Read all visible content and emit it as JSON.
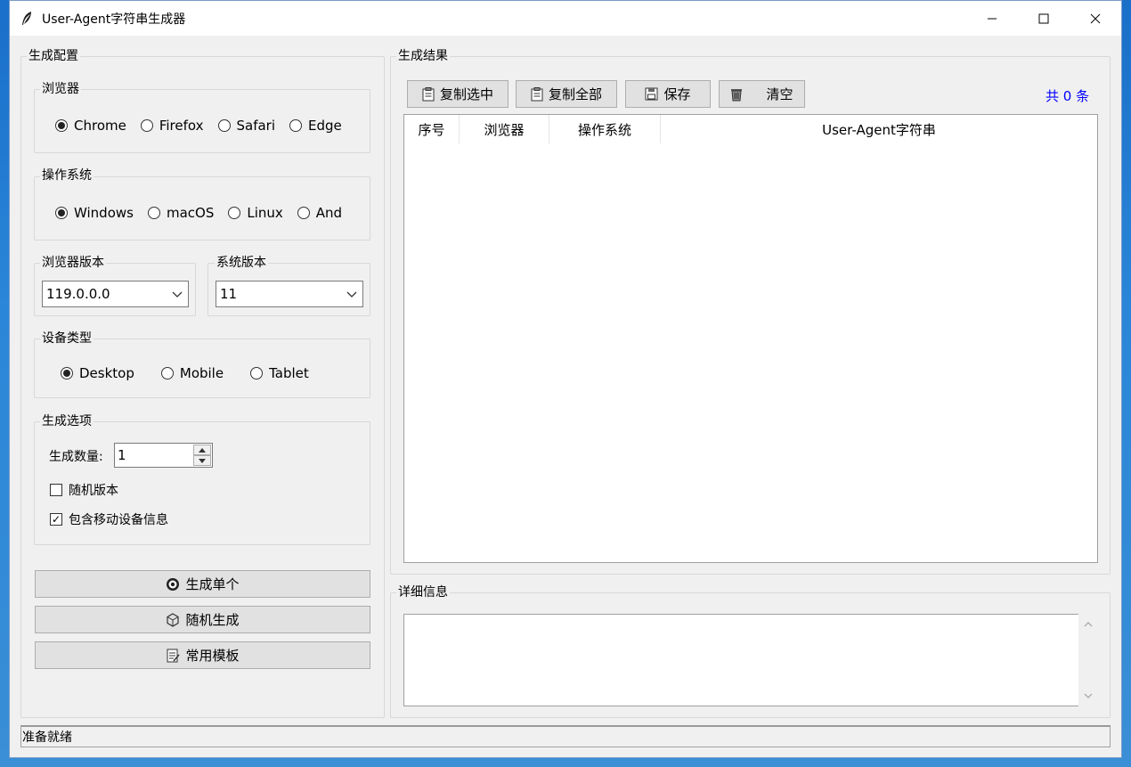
{
  "window": {
    "title": "User-Agent字符串生成器"
  },
  "config": {
    "title": "生成配置",
    "browser": {
      "title": "浏览器",
      "options": [
        "Chrome",
        "Firefox",
        "Safari",
        "Edge"
      ],
      "selected": "Chrome"
    },
    "os": {
      "title": "操作系统",
      "options": [
        "Windows",
        "macOS",
        "Linux",
        "And"
      ],
      "selected": "Windows"
    },
    "browser_version": {
      "title": "浏览器版本",
      "value": "119.0.0.0"
    },
    "os_version": {
      "title": "系统版本",
      "value": "11"
    },
    "device": {
      "title": "设备类型",
      "options": [
        "Desktop",
        "Mobile",
        "Tablet"
      ],
      "selected": "Desktop"
    },
    "options": {
      "title": "生成选项",
      "count_label": "生成数量:",
      "count_value": "1",
      "random_version_label": "随机版本",
      "random_version_checked": false,
      "include_mobile_label": "包含移动设备信息",
      "include_mobile_checked": true
    },
    "buttons": {
      "generate_single": "生成单个",
      "random_generate": "随机生成",
      "templates": "常用模板"
    }
  },
  "results": {
    "title": "生成结果",
    "toolbar": {
      "copy_selected": "复制选中",
      "copy_all": "复制全部",
      "save": "保存",
      "clear": "清空"
    },
    "count_text": "共 0 条",
    "columns": [
      "序号",
      "浏览器",
      "操作系统",
      "User-Agent字符串"
    ],
    "rows": []
  },
  "details": {
    "title": "详细信息",
    "text": ""
  },
  "status": {
    "text": "准备就绪"
  },
  "colors": {
    "count_text": "#0000ff",
    "window_bg": "#f0f0f0"
  }
}
